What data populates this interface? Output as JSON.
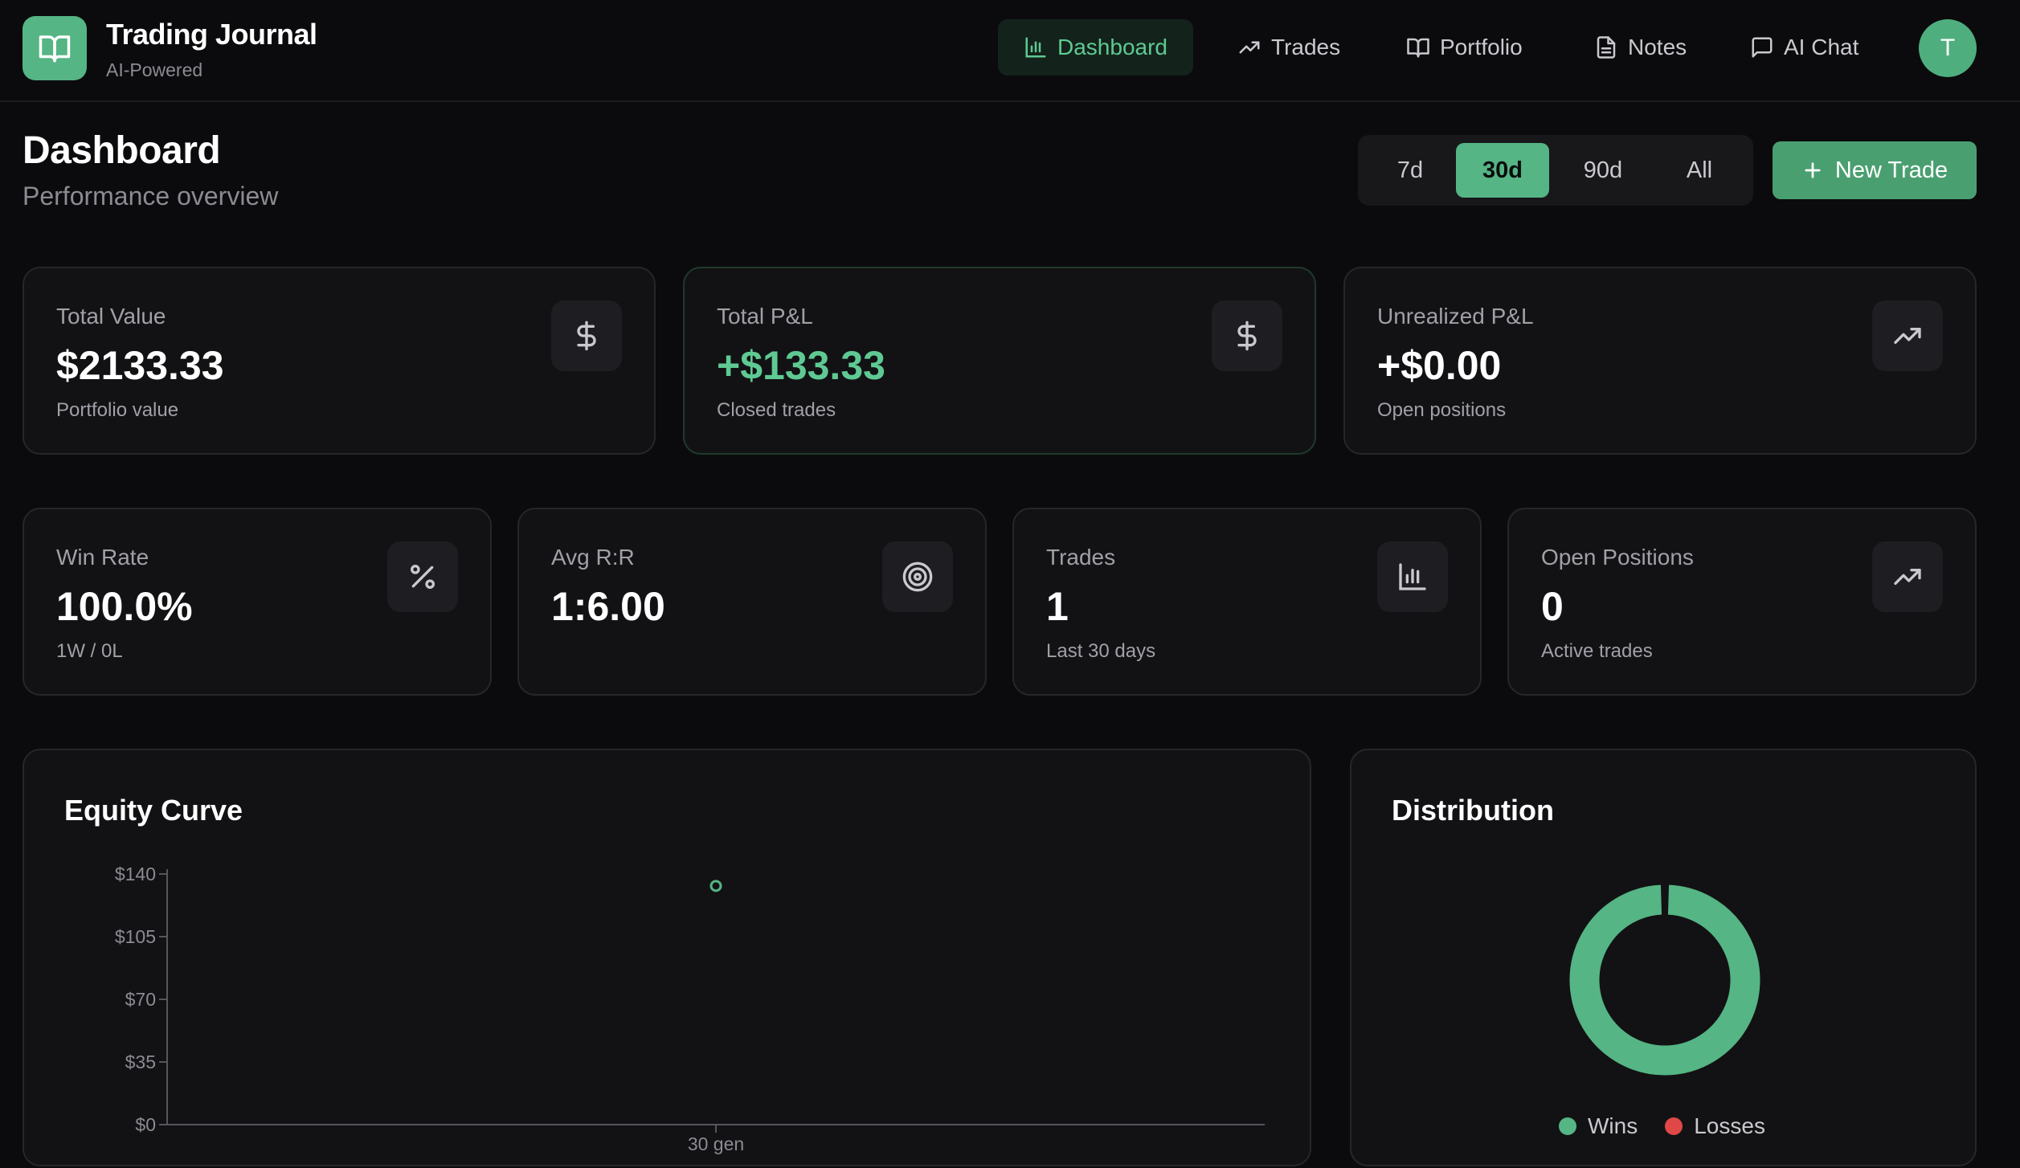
{
  "header": {
    "app_title": "Trading Journal",
    "app_subtitle": "AI-Powered",
    "nav": [
      {
        "label": "Dashboard",
        "icon": "bar-chart-icon",
        "active": true
      },
      {
        "label": "Trades",
        "icon": "trending-up-icon"
      },
      {
        "label": "Portfolio",
        "icon": "book-open-icon"
      },
      {
        "label": "Notes",
        "icon": "file-text-icon"
      },
      {
        "label": "AI Chat",
        "icon": "message-icon"
      }
    ],
    "avatar_initial": "T"
  },
  "page": {
    "title": "Dashboard",
    "subtitle": "Performance overview",
    "ranges": [
      "7d",
      "30d",
      "90d",
      "All"
    ],
    "selected_range": "30d",
    "new_trade_label": "New Trade"
  },
  "stats_top": [
    {
      "label": "Total Value",
      "value": "$2133.33",
      "sub": "Portfolio value",
      "icon": "dollar-icon"
    },
    {
      "label": "Total P&L",
      "value": "+$133.33",
      "sub": "Closed trades",
      "icon": "dollar-icon"
    },
    {
      "label": "Unrealized P&L",
      "value": "+$0.00",
      "sub": "Open positions",
      "icon": "trending-up-icon"
    }
  ],
  "stats_bottom": [
    {
      "label": "Win Rate",
      "value": "100.0%",
      "sub": "1W / 0L",
      "icon": "percent-icon"
    },
    {
      "label": "Avg R:R",
      "value": "1:6.00",
      "sub": "",
      "icon": "target-icon"
    },
    {
      "label": "Trades",
      "value": "1",
      "sub": "Last 30 days",
      "icon": "bar-chart-icon"
    },
    {
      "label": "Open Positions",
      "value": "0",
      "sub": "Active trades",
      "icon": "trending-up-icon"
    }
  ],
  "colors": {
    "accent": "#55b584",
    "positive": "#5fc993",
    "loss": "#e04848",
    "background": "#0b0b0d",
    "card": "#121214"
  },
  "equity_panel": {
    "title": "Equity Curve"
  },
  "distribution_panel": {
    "title": "Distribution"
  },
  "chart_data": [
    {
      "type": "line",
      "title": "Equity Curve",
      "x": [
        "30 gen"
      ],
      "series": [
        {
          "values": [
            133.33
          ]
        }
      ],
      "y_ticks": [
        "$140",
        "$105",
        "$70",
        "$35",
        "$0"
      ],
      "ylim": [
        0,
        140
      ],
      "grid": false
    },
    {
      "type": "pie",
      "title": "Distribution",
      "labels": [
        "Wins",
        "Losses"
      ],
      "values": [
        1,
        0
      ],
      "colors": [
        "#55b584",
        "#e04848"
      ],
      "legend": "bottom"
    }
  ]
}
